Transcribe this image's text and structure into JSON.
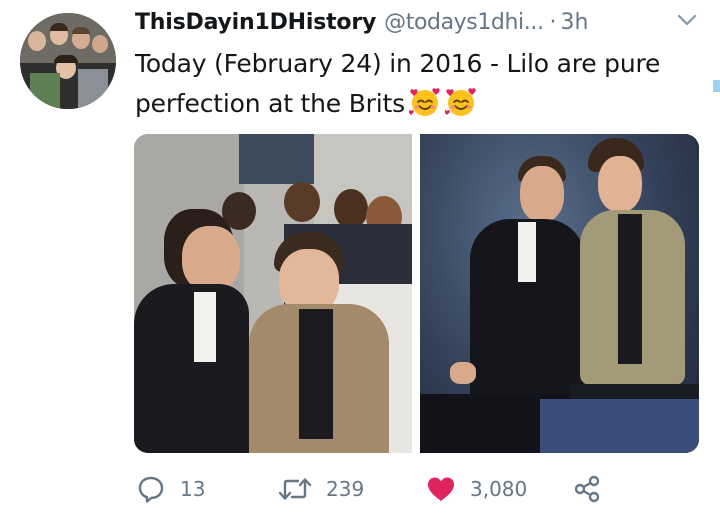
{
  "tweet": {
    "display_name": "ThisDayin1DHistory",
    "handle": "@todays1dhi...",
    "separator": "·",
    "time": "3h",
    "text": "Today (February 24) in 2016 - Lilo are pure perfection at the Brits",
    "emojis": [
      "smiling-face-with-hearts",
      "smiling-face-with-hearts"
    ]
  },
  "media": {
    "photos": [
      {
        "subject": "Two men in suits on red carpet with fans behind"
      },
      {
        "subject": "Two men in suits posing against blue backdrop"
      }
    ]
  },
  "actions": {
    "replies": "13",
    "retweets": "239",
    "likes": "3,080",
    "liked": true,
    "like_color": "#e0245e",
    "icon_color": "#657786"
  }
}
